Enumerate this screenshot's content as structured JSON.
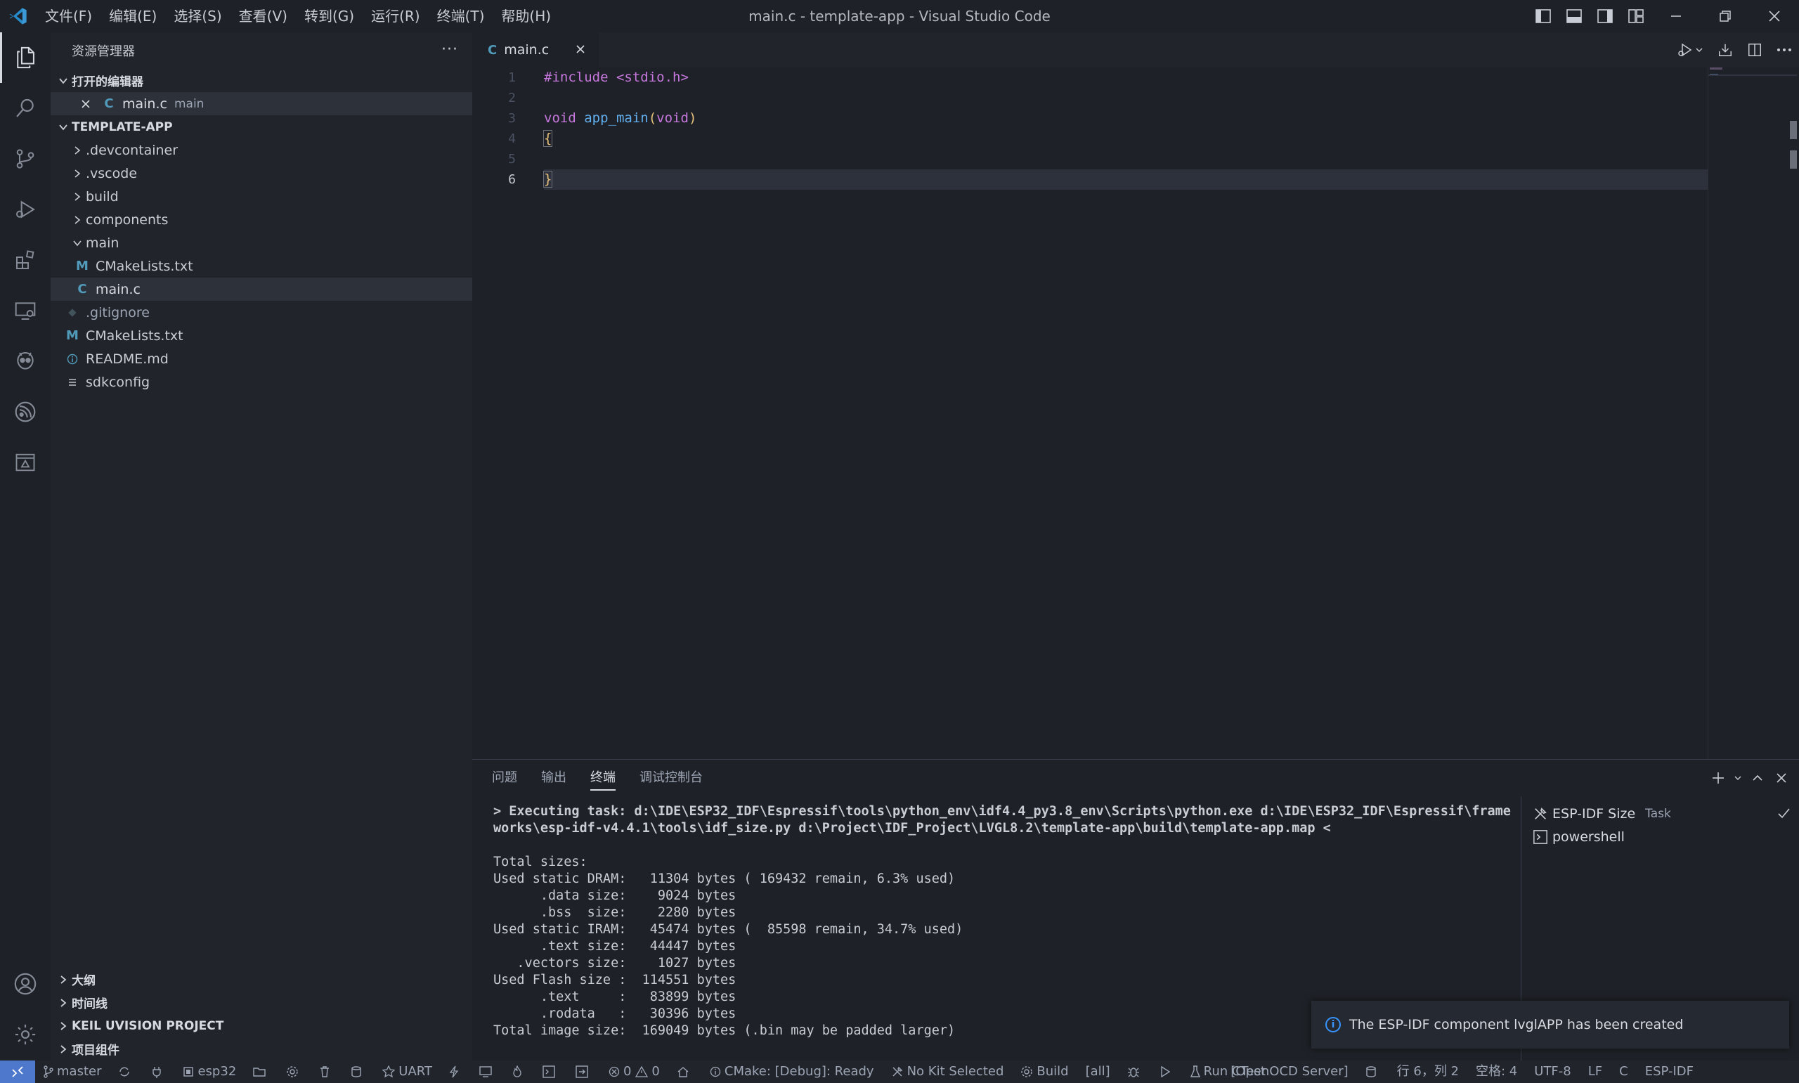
{
  "window": {
    "title": "main.c - template-app - Visual Studio Code",
    "menu": [
      "文件(F)",
      "编辑(E)",
      "选择(S)",
      "查看(V)",
      "转到(G)",
      "运行(R)",
      "终端(T)",
      "帮助(H)"
    ]
  },
  "sidebar": {
    "title": "资源管理器",
    "more": "···",
    "open_editors": {
      "label": "打开的编辑器",
      "items": [
        {
          "lang": "C",
          "name": "main.c",
          "desc": "main"
        }
      ]
    },
    "project": {
      "label": "TEMPLATE-APP",
      "items": [
        {
          "name": ".devcontainer"
        },
        {
          "name": ".vscode"
        },
        {
          "name": "build"
        },
        {
          "name": "components"
        },
        {
          "name": "main"
        },
        {
          "name": "CMakeLists.txt",
          "icon": "M"
        },
        {
          "name": "main.c",
          "icon": "C"
        },
        {
          "name": ".gitignore"
        },
        {
          "name": "CMakeLists.txt",
          "icon": "M"
        },
        {
          "name": "README.md"
        },
        {
          "name": "sdkconfig"
        }
      ]
    },
    "bottom_sections": [
      "大纲",
      "时间线",
      "KEIL UVISION PROJECT",
      "项目组件"
    ]
  },
  "editor": {
    "tab": {
      "lang": "C",
      "label": "main.c"
    },
    "line_numbers": [
      "1",
      "2",
      "3",
      "4",
      "5",
      "6"
    ],
    "lines": [
      {
        "t1": "#include <stdio.h>"
      },
      {
        "t1": ""
      },
      {
        "kw": "void",
        "fn": " app_main",
        "p1": "(",
        "kw2": "void",
        "p2": ")"
      },
      {
        "br": "{"
      },
      {
        "t1": ""
      },
      {
        "br": "}"
      }
    ]
  },
  "panel": {
    "tabs": [
      "问题",
      "输出",
      "终端",
      "调试控制台"
    ],
    "terminal_lines": [
      "> Executing task: d:\\IDE\\ESP32_IDF\\Espressif\\tools\\python_env\\idf4.4_py3.8_env\\Scripts\\python.exe d:\\IDE\\ESP32_IDF\\Espressif\\frame",
      "works\\esp-idf-v4.4.1\\tools\\idf_size.py d:\\Project\\IDF_Project\\LVGL8.2\\template-app\\build\\template-app.map <",
      "",
      "Total sizes:",
      "Used static DRAM:   11304 bytes ( 169432 remain, 6.3% used)",
      "      .data size:    9024 bytes",
      "      .bss  size:    2280 bytes",
      "Used static IRAM:   45474 bytes (  85598 remain, 34.7% used)",
      "      .text size:   44447 bytes",
      "   .vectors size:    1027 bytes",
      "Used Flash size :  114551 bytes",
      "      .text     :   83899 bytes",
      "      .rodata   :   30396 bytes",
      "Total image size:  169049 bytes (.bin may be padded larger)"
    ],
    "terminals": [
      {
        "name": "ESP-IDF Size",
        "sub": "Task"
      },
      {
        "name": "powershell",
        "sub": ""
      }
    ]
  },
  "toast": {
    "message": "The ESP-IDF component lvglAPP has been created"
  },
  "statusbar": {
    "branch": "master",
    "target": "esp32",
    "uart": "UART",
    "errors": "0",
    "warnings": "0",
    "cmake": "CMake: [Debug]: Ready",
    "kit": "No Kit Selected",
    "build": "Build",
    "all": "[all]",
    "ctest": "Run CTest",
    "openocd": "[OpenOCD Server]",
    "position": "行 6，列 2",
    "spaces": "空格: 4",
    "encoding": "UTF-8",
    "eol": "LF",
    "language": "C",
    "espidf": "ESP-IDF"
  },
  "colors": {
    "accent": "#4d78cc",
    "c_icon": "#519aba",
    "cmake_icon": "#519aba",
    "keyword": "#c678dd",
    "function": "#61afef",
    "bracket": "#e5c07b"
  }
}
